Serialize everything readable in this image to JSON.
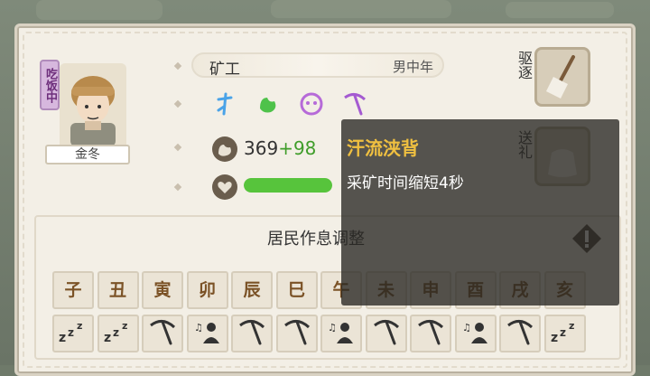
{
  "resident": {
    "status_tag": "吃饭中",
    "name": "金冬",
    "job": "矿工",
    "age_group": "男中年",
    "traits": [
      {
        "icon": "talent-icon",
        "color": "#4aa3e8"
      },
      {
        "icon": "strength-icon",
        "color": "#4ec24a"
      },
      {
        "icon": "mood-icon",
        "color": "#b66ad8"
      },
      {
        "icon": "pickaxe-skill-icon",
        "color": "#a45ad1"
      }
    ],
    "stat_value": "369",
    "stat_bonus": "+98",
    "health_fraction": 1.0
  },
  "actions": {
    "expel_label": "驱逐",
    "gift_label": "送礼"
  },
  "schedule": {
    "title": "居民作息调整",
    "hours": [
      "子",
      "丑",
      "寅",
      "卯",
      "辰",
      "巳",
      "午",
      "未",
      "申",
      "酉",
      "戌",
      "亥"
    ],
    "activities": [
      "sleep",
      "sleep",
      "work",
      "rest",
      "work",
      "work",
      "rest",
      "work",
      "work",
      "rest",
      "work",
      "sleep"
    ]
  },
  "tooltip": {
    "title": "汗流浃背",
    "description": "采矿时间缩短4秒"
  }
}
